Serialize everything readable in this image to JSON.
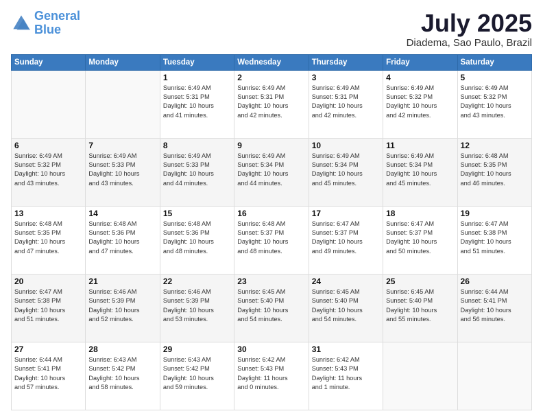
{
  "header": {
    "logo_line1": "General",
    "logo_line2": "Blue",
    "title": "July 2025",
    "location": "Diadema, Sao Paulo, Brazil"
  },
  "weekdays": [
    "Sunday",
    "Monday",
    "Tuesday",
    "Wednesday",
    "Thursday",
    "Friday",
    "Saturday"
  ],
  "weeks": [
    [
      {
        "day": "",
        "info": ""
      },
      {
        "day": "",
        "info": ""
      },
      {
        "day": "1",
        "info": "Sunrise: 6:49 AM\nSunset: 5:31 PM\nDaylight: 10 hours\nand 41 minutes."
      },
      {
        "day": "2",
        "info": "Sunrise: 6:49 AM\nSunset: 5:31 PM\nDaylight: 10 hours\nand 42 minutes."
      },
      {
        "day": "3",
        "info": "Sunrise: 6:49 AM\nSunset: 5:31 PM\nDaylight: 10 hours\nand 42 minutes."
      },
      {
        "day": "4",
        "info": "Sunrise: 6:49 AM\nSunset: 5:32 PM\nDaylight: 10 hours\nand 42 minutes."
      },
      {
        "day": "5",
        "info": "Sunrise: 6:49 AM\nSunset: 5:32 PM\nDaylight: 10 hours\nand 43 minutes."
      }
    ],
    [
      {
        "day": "6",
        "info": "Sunrise: 6:49 AM\nSunset: 5:32 PM\nDaylight: 10 hours\nand 43 minutes."
      },
      {
        "day": "7",
        "info": "Sunrise: 6:49 AM\nSunset: 5:33 PM\nDaylight: 10 hours\nand 43 minutes."
      },
      {
        "day": "8",
        "info": "Sunrise: 6:49 AM\nSunset: 5:33 PM\nDaylight: 10 hours\nand 44 minutes."
      },
      {
        "day": "9",
        "info": "Sunrise: 6:49 AM\nSunset: 5:34 PM\nDaylight: 10 hours\nand 44 minutes."
      },
      {
        "day": "10",
        "info": "Sunrise: 6:49 AM\nSunset: 5:34 PM\nDaylight: 10 hours\nand 45 minutes."
      },
      {
        "day": "11",
        "info": "Sunrise: 6:49 AM\nSunset: 5:34 PM\nDaylight: 10 hours\nand 45 minutes."
      },
      {
        "day": "12",
        "info": "Sunrise: 6:48 AM\nSunset: 5:35 PM\nDaylight: 10 hours\nand 46 minutes."
      }
    ],
    [
      {
        "day": "13",
        "info": "Sunrise: 6:48 AM\nSunset: 5:35 PM\nDaylight: 10 hours\nand 47 minutes."
      },
      {
        "day": "14",
        "info": "Sunrise: 6:48 AM\nSunset: 5:36 PM\nDaylight: 10 hours\nand 47 minutes."
      },
      {
        "day": "15",
        "info": "Sunrise: 6:48 AM\nSunset: 5:36 PM\nDaylight: 10 hours\nand 48 minutes."
      },
      {
        "day": "16",
        "info": "Sunrise: 6:48 AM\nSunset: 5:37 PM\nDaylight: 10 hours\nand 48 minutes."
      },
      {
        "day": "17",
        "info": "Sunrise: 6:47 AM\nSunset: 5:37 PM\nDaylight: 10 hours\nand 49 minutes."
      },
      {
        "day": "18",
        "info": "Sunrise: 6:47 AM\nSunset: 5:37 PM\nDaylight: 10 hours\nand 50 minutes."
      },
      {
        "day": "19",
        "info": "Sunrise: 6:47 AM\nSunset: 5:38 PM\nDaylight: 10 hours\nand 51 minutes."
      }
    ],
    [
      {
        "day": "20",
        "info": "Sunrise: 6:47 AM\nSunset: 5:38 PM\nDaylight: 10 hours\nand 51 minutes."
      },
      {
        "day": "21",
        "info": "Sunrise: 6:46 AM\nSunset: 5:39 PM\nDaylight: 10 hours\nand 52 minutes."
      },
      {
        "day": "22",
        "info": "Sunrise: 6:46 AM\nSunset: 5:39 PM\nDaylight: 10 hours\nand 53 minutes."
      },
      {
        "day": "23",
        "info": "Sunrise: 6:45 AM\nSunset: 5:40 PM\nDaylight: 10 hours\nand 54 minutes."
      },
      {
        "day": "24",
        "info": "Sunrise: 6:45 AM\nSunset: 5:40 PM\nDaylight: 10 hours\nand 54 minutes."
      },
      {
        "day": "25",
        "info": "Sunrise: 6:45 AM\nSunset: 5:40 PM\nDaylight: 10 hours\nand 55 minutes."
      },
      {
        "day": "26",
        "info": "Sunrise: 6:44 AM\nSunset: 5:41 PM\nDaylight: 10 hours\nand 56 minutes."
      }
    ],
    [
      {
        "day": "27",
        "info": "Sunrise: 6:44 AM\nSunset: 5:41 PM\nDaylight: 10 hours\nand 57 minutes."
      },
      {
        "day": "28",
        "info": "Sunrise: 6:43 AM\nSunset: 5:42 PM\nDaylight: 10 hours\nand 58 minutes."
      },
      {
        "day": "29",
        "info": "Sunrise: 6:43 AM\nSunset: 5:42 PM\nDaylight: 10 hours\nand 59 minutes."
      },
      {
        "day": "30",
        "info": "Sunrise: 6:42 AM\nSunset: 5:43 PM\nDaylight: 11 hours\nand 0 minutes."
      },
      {
        "day": "31",
        "info": "Sunrise: 6:42 AM\nSunset: 5:43 PM\nDaylight: 11 hours\nand 1 minute."
      },
      {
        "day": "",
        "info": ""
      },
      {
        "day": "",
        "info": ""
      }
    ]
  ]
}
